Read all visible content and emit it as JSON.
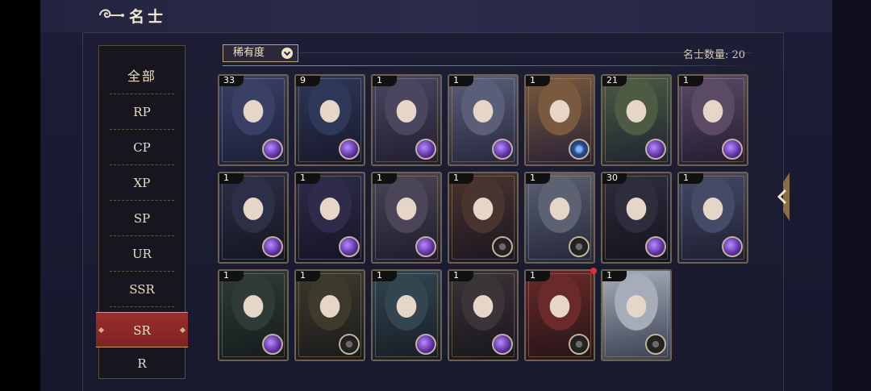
{
  "header": {
    "title": "名士",
    "title_icon": "swirl-cloud-icon"
  },
  "sidebar": {
    "items": [
      {
        "label": "全部"
      },
      {
        "label": "RP"
      },
      {
        "label": "CP"
      },
      {
        "label": "XP"
      },
      {
        "label": "SP"
      },
      {
        "label": "UR"
      },
      {
        "label": "SSR"
      },
      {
        "label": "SR",
        "active": true
      },
      {
        "label": "R"
      }
    ]
  },
  "filter": {
    "label": "稀有度",
    "icon": "chevron-down-icon"
  },
  "count_label": "名士数量: 20",
  "cards": [
    {
      "num": "33",
      "orb": "purple"
    },
    {
      "num": "9",
      "orb": "purple"
    },
    {
      "num": "1",
      "orb": "purple"
    },
    {
      "num": "1",
      "orb": "purple"
    },
    {
      "num": "1",
      "orb": "blue"
    },
    {
      "num": "21",
      "orb": "purple"
    },
    {
      "num": "1",
      "orb": "purple"
    },
    {
      "num": "1",
      "orb": "purple"
    },
    {
      "num": "1",
      "orb": "purple"
    },
    {
      "num": "1",
      "orb": "purple"
    },
    {
      "num": "1",
      "orb": "dark"
    },
    {
      "num": "1",
      "orb": "dark"
    },
    {
      "num": "30",
      "orb": "purple"
    },
    {
      "num": "1",
      "orb": "purple"
    },
    {
      "num": "1",
      "orb": "purple"
    },
    {
      "num": "1",
      "orb": "dark"
    },
    {
      "num": "1",
      "orb": "purple"
    },
    {
      "num": "1",
      "orb": "purple"
    },
    {
      "num": "1",
      "orb": "dark",
      "notify": true
    },
    {
      "num": "1",
      "orb": "dark"
    }
  ],
  "colors": {
    "accent_gold": "#bfa47a",
    "active_red": "#9b2f2f",
    "background": "#1b1d36"
  }
}
